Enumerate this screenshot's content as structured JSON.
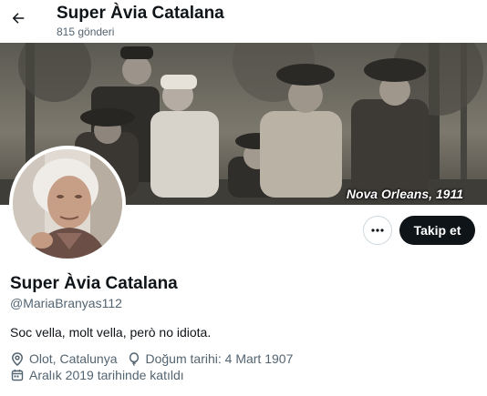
{
  "header": {
    "title": "Super Àvia Catalana",
    "post_count": "815 gönderi"
  },
  "banner": {
    "caption": "Nova Orleans, 1911"
  },
  "actions": {
    "follow_label": "Takip et"
  },
  "profile": {
    "name": "Super Àvia Catalana",
    "handle": "@MariaBranyas112",
    "bio": "Soc vella, molt vella, però no idiota.",
    "location": "Olot, Catalunya",
    "birthday": "Doğum tarihi: 4 Mart 1907",
    "joined": "Aralık 2019 tarihinde katıldı"
  },
  "icons": {
    "back": "arrow-left-icon",
    "more": "more-dots-icon",
    "location": "location-pin-icon",
    "birthday": "balloon-icon",
    "joined": "calendar-icon"
  }
}
